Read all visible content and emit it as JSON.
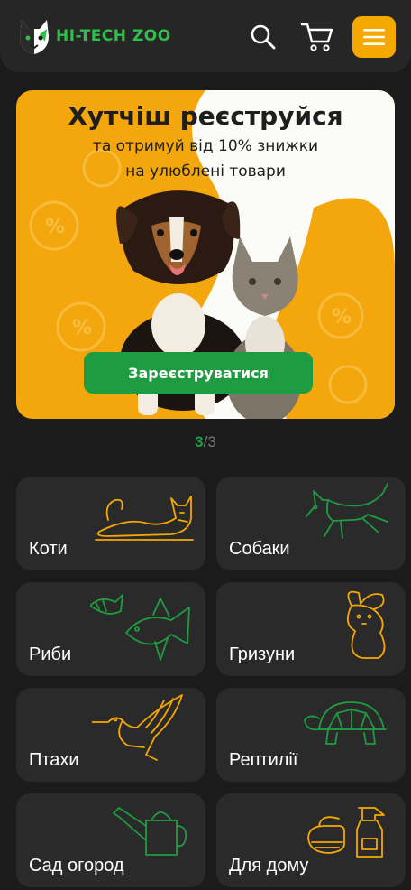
{
  "header": {
    "brand": "HI-TECH ZOO",
    "icons": [
      "logo-icon",
      "search-icon",
      "cart-icon",
      "menu-icon"
    ],
    "accent": "#f5a800",
    "brand_color": "#2fbf4a"
  },
  "banner": {
    "title": "Хутчіш реєструйся",
    "subtitle_line1": "та отримуй від 10% знижки",
    "subtitle_line2": "на улюблені товари",
    "cta": "Зареєструватися",
    "cta_color": "#1e9c41"
  },
  "pager": {
    "current": "3",
    "separator": "/",
    "total": "3"
  },
  "categories": [
    {
      "label": "Коти",
      "icon": "cat-icon"
    },
    {
      "label": "Собаки",
      "icon": "dog-icon"
    },
    {
      "label": "Риби",
      "icon": "fish-icon"
    },
    {
      "label": "Гризуни",
      "icon": "rabbit-icon"
    },
    {
      "label": "Птахи",
      "icon": "bird-icon"
    },
    {
      "label": "Рептилії",
      "icon": "turtle-icon"
    },
    {
      "label": "Сад огород",
      "icon": "watering-can-icon"
    },
    {
      "label": "Для дому",
      "icon": "cleaning-icon"
    }
  ]
}
